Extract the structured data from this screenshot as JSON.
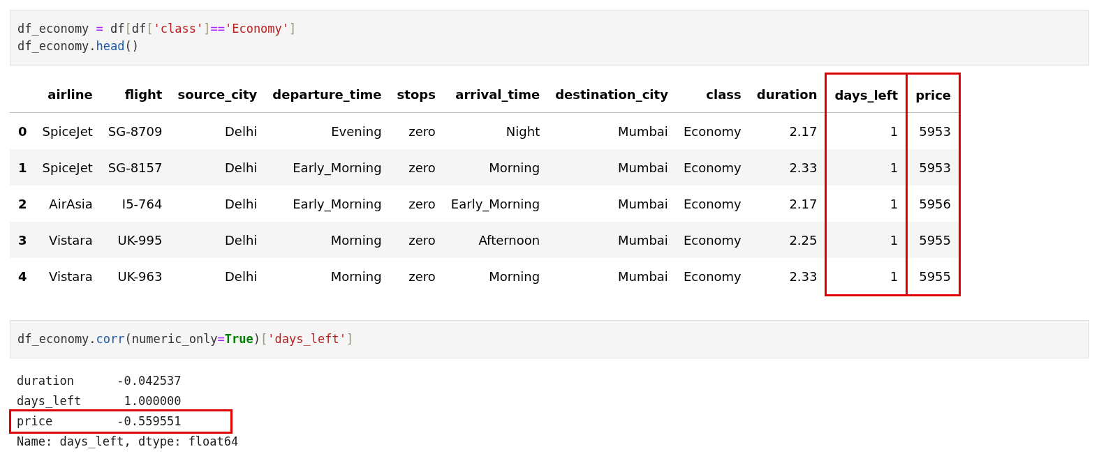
{
  "cells": [
    {
      "code": [
        [
          {
            "text": "df_economy ",
            "kind": "plain"
          },
          {
            "text": "=",
            "kind": "op"
          },
          {
            "text": " df",
            "kind": "plain"
          },
          {
            "text": "[",
            "kind": "bracket"
          },
          {
            "text": "df",
            "kind": "plain"
          },
          {
            "text": "[",
            "kind": "bracket"
          },
          {
            "text": "'class'",
            "kind": "string"
          },
          {
            "text": "]",
            "kind": "bracket"
          },
          {
            "text": "==",
            "kind": "op"
          },
          {
            "text": "'Economy'",
            "kind": "string"
          },
          {
            "text": "]",
            "kind": "bracket"
          }
        ],
        [
          {
            "text": "df_economy.",
            "kind": "plain"
          },
          {
            "text": "head",
            "kind": "func"
          },
          {
            "text": "()",
            "kind": "plain"
          }
        ]
      ],
      "output": {
        "kind": "table",
        "columns": [
          {
            "label": "airline",
            "highlighted": false
          },
          {
            "label": "flight",
            "highlighted": false
          },
          {
            "label": "source_city",
            "highlighted": false
          },
          {
            "label": "departure_time",
            "highlighted": false
          },
          {
            "label": "stops",
            "highlighted": false
          },
          {
            "label": "arrival_time",
            "highlighted": false
          },
          {
            "label": "destination_city",
            "highlighted": false
          },
          {
            "label": "class",
            "highlighted": false
          },
          {
            "label": "duration",
            "highlighted": false
          },
          {
            "label": "days_left",
            "highlighted": true
          },
          {
            "label": "price",
            "highlighted": true
          }
        ],
        "rows": [
          {
            "index": "0",
            "cells": [
              "SpiceJet",
              "SG-8709",
              "Delhi",
              "Evening",
              "zero",
              "Night",
              "Mumbai",
              "Economy",
              "2.17",
              "1",
              "5953"
            ]
          },
          {
            "index": "1",
            "cells": [
              "SpiceJet",
              "SG-8157",
              "Delhi",
              "Early_Morning",
              "zero",
              "Morning",
              "Mumbai",
              "Economy",
              "2.33",
              "1",
              "5953"
            ]
          },
          {
            "index": "2",
            "cells": [
              "AirAsia",
              "I5-764",
              "Delhi",
              "Early_Morning",
              "zero",
              "Early_Morning",
              "Mumbai",
              "Economy",
              "2.17",
              "1",
              "5956"
            ]
          },
          {
            "index": "3",
            "cells": [
              "Vistara",
              "UK-995",
              "Delhi",
              "Morning",
              "zero",
              "Afternoon",
              "Mumbai",
              "Economy",
              "2.25",
              "1",
              "5955"
            ]
          },
          {
            "index": "4",
            "cells": [
              "Vistara",
              "UK-963",
              "Delhi",
              "Morning",
              "zero",
              "Morning",
              "Mumbai",
              "Economy",
              "2.33",
              "1",
              "5955"
            ]
          }
        ]
      }
    },
    {
      "code": [
        [
          {
            "text": "df_economy.",
            "kind": "plain"
          },
          {
            "text": "corr",
            "kind": "func"
          },
          {
            "text": "(numeric_only",
            "kind": "plain"
          },
          {
            "text": "=",
            "kind": "op"
          },
          {
            "text": "True",
            "kind": "keyword"
          },
          {
            "text": ")",
            "kind": "plain"
          },
          {
            "text": "[",
            "kind": "bracket"
          },
          {
            "text": "'days_left'",
            "kind": "string"
          },
          {
            "text": "]",
            "kind": "bracket"
          }
        ]
      ],
      "output": {
        "kind": "text",
        "lines": [
          {
            "text": "duration      -0.042537",
            "highlighted": false
          },
          {
            "text": "days_left      1.000000",
            "highlighted": false
          },
          {
            "text": "price         -0.559551",
            "highlighted": true
          },
          {
            "text": "Name: days_left, dtype: float64",
            "highlighted": false
          }
        ]
      }
    }
  ]
}
